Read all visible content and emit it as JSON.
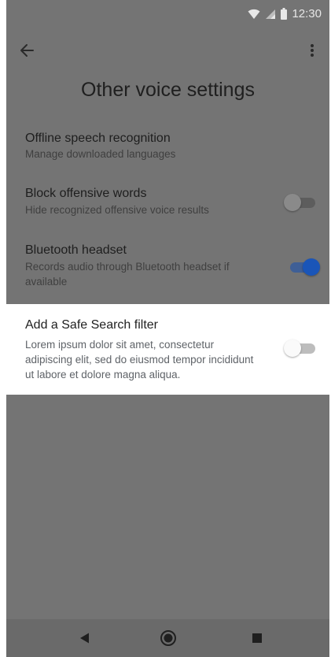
{
  "status_bar": {
    "time": "12:30",
    "icons": [
      "wifi-icon",
      "cell-signal-icon",
      "battery-icon"
    ]
  },
  "app_bar": {
    "back_icon": "arrow-back-icon",
    "menu_icon": "more-vert-icon"
  },
  "page": {
    "title": "Other voice settings"
  },
  "settings": [
    {
      "title": "Offline speech recognition",
      "subtitle": "Manage downloaded languages"
    },
    {
      "title": "Block offensive words",
      "subtitle": "Hide recognized offensive voice results",
      "toggle_on": false
    },
    {
      "title": "Bluetooth headset",
      "subtitle": "Records audio through Bluetooth headset if available",
      "toggle_on": true
    },
    {
      "title": "Add a Safe Search filter",
      "subtitle": "Lorem ipsum dolor sit amet, consectetur adipiscing elit, sed do eiusmod tempor incididunt ut labore et dolore magna aliqua.",
      "toggle_on": false
    }
  ],
  "nav_bar": {
    "icons": [
      "nav-back-icon",
      "nav-home-icon",
      "nav-recents-icon"
    ]
  },
  "colors": {
    "scrim": "#747474",
    "accent": "#1a55b8",
    "card": "#ffffff"
  }
}
